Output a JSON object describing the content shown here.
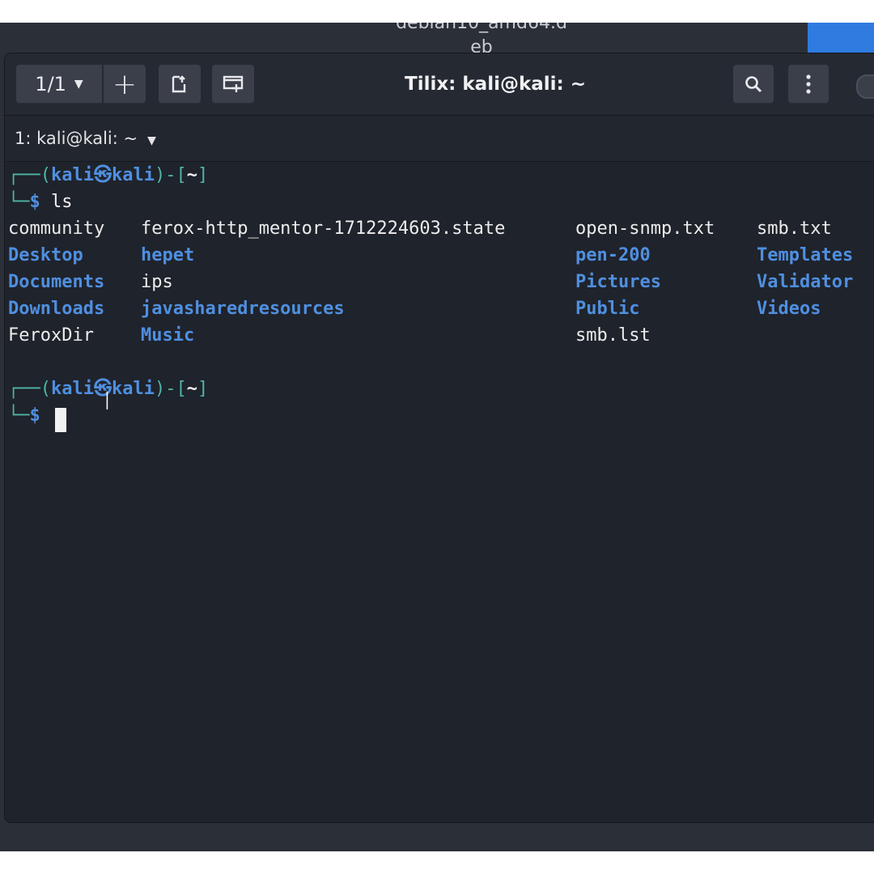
{
  "desktop": {
    "file_label": "debian10_amd64.d",
    "file_label_2": "eb"
  },
  "header": {
    "session_label": "1/1",
    "add_label": "+",
    "title": "Tilix: kali@kali: ~"
  },
  "tab": {
    "label": "1: kali@kali: ~"
  },
  "terminal": {
    "prompt_user": "kali",
    "prompt_host": "kali",
    "prompt_dir": "~",
    "command": "ls",
    "ls_columns": [
      [
        "community",
        "Desktop",
        "Documents",
        "Downloads",
        "FeroxDir"
      ],
      [
        "ferox-http_mentor-1712224603.state",
        "hepet",
        "ips",
        "javasharedresources",
        "Music"
      ],
      [
        "open-snmp.txt",
        "pen-200",
        "Pictures",
        "Public",
        "smb.lst"
      ],
      [
        "smb.txt",
        "Templates",
        "Validator",
        "Videos"
      ]
    ],
    "directories": [
      "Desktop",
      "Documents",
      "Downloads",
      "hepet",
      "javasharedresources",
      "Music",
      "pen-200",
      "Pictures",
      "Public",
      "Templates",
      "Validator",
      "Videos"
    ]
  },
  "colors": {
    "directory": "#4f8fe0",
    "prompt_frame": "#4fb5a8",
    "background": "#1f232b",
    "accent_tab": "#2f7be0"
  },
  "icons": {
    "session_caret": "chevron-down-icon",
    "add": "plus-icon",
    "detach": "detach-terminal-icon",
    "new_window": "new-window-icon",
    "search": "search-icon",
    "menu": "kebab-menu-icon",
    "tab_caret": "chevron-down-icon"
  }
}
